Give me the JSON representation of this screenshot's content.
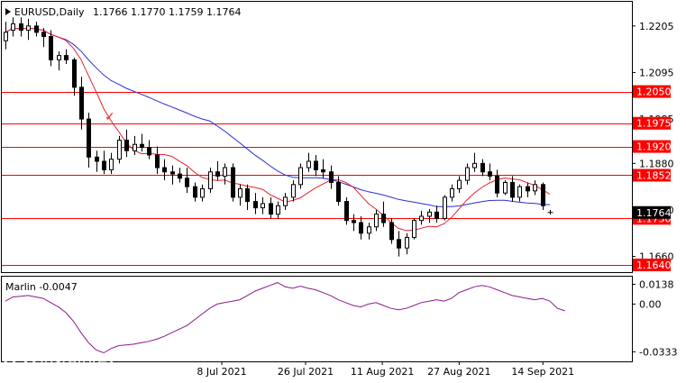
{
  "header": {
    "symbol_text": "EURUSD,Daily",
    "ohlc_text": "1.1766 1.1770 1.1759 1.1764"
  },
  "colors": {
    "background": "#ffffff",
    "frame": "#000000",
    "level_line": "#ff0000",
    "ma_fast": "#e8202a",
    "ma_slow": "#2a2fd6",
    "oscillator": "#8b1a8b",
    "price_label_bg": "#000000",
    "level_label_bg": "#ff0000",
    "checkmark": "#ff2020"
  },
  "chart_data": {
    "type": "candlestick",
    "symbol": "EURUSD",
    "timeframe": "Daily",
    "y_ticks": [
      "1.2205",
      "1.2095",
      "1.1985",
      "1.1880",
      "1.1770",
      "1.1660"
    ],
    "ylim": [
      1.1625,
      1.226
    ],
    "levels": [
      "1.2050",
      "1.1975",
      "1.1920",
      "1.1852",
      "1.1750",
      "1.1640"
    ],
    "current_price": "1.1764",
    "x_tick_labels": [
      "8 Jul 2021",
      "26 Jul 2021",
      "11 Aug 2021",
      "27 Aug 2021",
      "14 Sep 2021"
    ],
    "candles": [
      [
        1.217,
        1.2215,
        1.215,
        1.219
      ],
      [
        1.2195,
        1.2225,
        1.218,
        1.221
      ],
      [
        1.221,
        1.2225,
        1.218,
        1.2195
      ],
      [
        1.2195,
        1.2222,
        1.2172,
        1.2205
      ],
      [
        1.2205,
        1.2215,
        1.218,
        1.219
      ],
      [
        1.219,
        1.22,
        1.2155,
        1.218
      ],
      [
        1.218,
        1.2195,
        1.211,
        1.2125
      ],
      [
        1.2125,
        1.2145,
        1.21,
        1.2135
      ],
      [
        1.2135,
        1.215,
        1.2115,
        1.2125
      ],
      [
        1.2125,
        1.213,
        1.204,
        1.206
      ],
      [
        1.206,
        1.2085,
        1.196,
        1.1985
      ],
      [
        1.1985,
        1.2,
        1.187,
        1.1895
      ],
      [
        1.1895,
        1.191,
        1.186,
        1.1885
      ],
      [
        1.1885,
        1.191,
        1.1855,
        1.1865
      ],
      [
        1.1865,
        1.1905,
        1.1855,
        1.189
      ],
      [
        1.189,
        1.1945,
        1.188,
        1.1935
      ],
      [
        1.1935,
        1.196,
        1.1895,
        1.191
      ],
      [
        1.191,
        1.1945,
        1.19,
        1.1925
      ],
      [
        1.1925,
        1.195,
        1.1908,
        1.1918
      ],
      [
        1.1918,
        1.1935,
        1.189,
        1.19
      ],
      [
        1.19,
        1.192,
        1.1855,
        1.187
      ],
      [
        1.187,
        1.189,
        1.184,
        1.186
      ],
      [
        1.186,
        1.1875,
        1.183,
        1.1855
      ],
      [
        1.1855,
        1.187,
        1.1835,
        1.1845
      ],
      [
        1.1845,
        1.187,
        1.181,
        1.1825
      ],
      [
        1.1825,
        1.1835,
        1.179,
        1.18
      ],
      [
        1.18,
        1.183,
        1.179,
        1.182
      ],
      [
        1.182,
        1.187,
        1.181,
        1.186
      ],
      [
        1.186,
        1.1885,
        1.184,
        1.185
      ],
      [
        1.185,
        1.188,
        1.183,
        1.187
      ],
      [
        1.187,
        1.188,
        1.179,
        1.18
      ],
      [
        1.18,
        1.183,
        1.178,
        1.182
      ],
      [
        1.182,
        1.183,
        1.177,
        1.179
      ],
      [
        1.179,
        1.181,
        1.176,
        1.1775
      ],
      [
        1.1775,
        1.18,
        1.176,
        1.1785
      ],
      [
        1.1785,
        1.18,
        1.175,
        1.176
      ],
      [
        1.176,
        1.179,
        1.175,
        1.178
      ],
      [
        1.178,
        1.181,
        1.177,
        1.18
      ],
      [
        1.18,
        1.184,
        1.179,
        1.183
      ],
      [
        1.183,
        1.188,
        1.182,
        1.187
      ],
      [
        1.187,
        1.1905,
        1.186,
        1.1885
      ],
      [
        1.1885,
        1.19,
        1.185,
        1.1865
      ],
      [
        1.1865,
        1.189,
        1.1845,
        1.186
      ],
      [
        1.186,
        1.1875,
        1.182,
        1.1835
      ],
      [
        1.1835,
        1.185,
        1.178,
        1.179
      ],
      [
        1.179,
        1.18,
        1.1735,
        1.1745
      ],
      [
        1.1745,
        1.176,
        1.172,
        1.174
      ],
      [
        1.174,
        1.1755,
        1.17,
        1.1715
      ],
      [
        1.1715,
        1.174,
        1.17,
        1.173
      ],
      [
        1.173,
        1.177,
        1.172,
        1.176
      ],
      [
        1.176,
        1.179,
        1.173,
        1.174
      ],
      [
        1.174,
        1.175,
        1.169,
        1.17
      ],
      [
        1.17,
        1.172,
        1.166,
        1.168
      ],
      [
        1.168,
        1.1715,
        1.1665,
        1.1705
      ],
      [
        1.1705,
        1.175,
        1.17,
        1.1745
      ],
      [
        1.1745,
        1.1768,
        1.1735,
        1.1755
      ],
      [
        1.1755,
        1.1772,
        1.174,
        1.1765
      ],
      [
        1.1765,
        1.178,
        1.174,
        1.175
      ],
      [
        1.175,
        1.1805,
        1.1745,
        1.18
      ],
      [
        1.18,
        1.183,
        1.179,
        1.182
      ],
      [
        1.182,
        1.185,
        1.181,
        1.184
      ],
      [
        1.184,
        1.188,
        1.183,
        1.187
      ],
      [
        1.187,
        1.1905,
        1.186,
        1.188
      ],
      [
        1.188,
        1.189,
        1.185,
        1.186
      ],
      [
        1.186,
        1.188,
        1.184,
        1.185
      ],
      [
        1.185,
        1.1865,
        1.18,
        1.181
      ],
      [
        1.181,
        1.184,
        1.1805,
        1.1835
      ],
      [
        1.1835,
        1.185,
        1.179,
        1.18
      ],
      [
        1.18,
        1.183,
        1.179,
        1.1825
      ],
      [
        1.1825,
        1.1835,
        1.18,
        1.1815
      ],
      [
        1.1815,
        1.184,
        1.1805,
        1.183
      ],
      [
        1.183,
        1.1835,
        1.177,
        1.178
      ],
      [
        1.1766,
        1.177,
        1.1759,
        1.1764
      ]
    ],
    "oscillator": {
      "label": "Marlin -0.0047",
      "y_ticks": [
        "0.0138",
        "0.00",
        "-0.0333"
      ],
      "ylim": [
        -0.04,
        0.0185
      ],
      "values": [
        0.002,
        0.005,
        0.0055,
        0.006,
        0.005,
        0.004,
        0.001,
        -0.002,
        -0.006,
        -0.012,
        -0.02,
        -0.027,
        -0.032,
        -0.034,
        -0.031,
        -0.029,
        -0.0285,
        -0.028,
        -0.027,
        -0.026,
        -0.0245,
        -0.0225,
        -0.02,
        -0.0175,
        -0.015,
        -0.011,
        -0.007,
        -0.003,
        0.0,
        0.001,
        0.002,
        0.003,
        0.006,
        0.009,
        0.011,
        0.013,
        0.015,
        0.012,
        0.011,
        0.0125,
        0.011,
        0.01,
        0.008,
        0.006,
        0.003,
        0.001,
        -0.001,
        -0.002,
        0.0,
        0.001,
        -0.001,
        -0.003,
        -0.004,
        -0.003,
        -0.001,
        0.001,
        0.002,
        0.003,
        0.002,
        0.004,
        0.008,
        0.01,
        0.012,
        0.013,
        0.012,
        0.01,
        0.008,
        0.006,
        0.005,
        0.004,
        0.003,
        0.004,
        0.002,
        -0.003,
        -0.0047
      ]
    }
  },
  "annotations": {
    "checkmark": "✓"
  },
  "watermark": {
    "brand": "instaforex",
    "tagline": "Instant Forex Trading"
  }
}
